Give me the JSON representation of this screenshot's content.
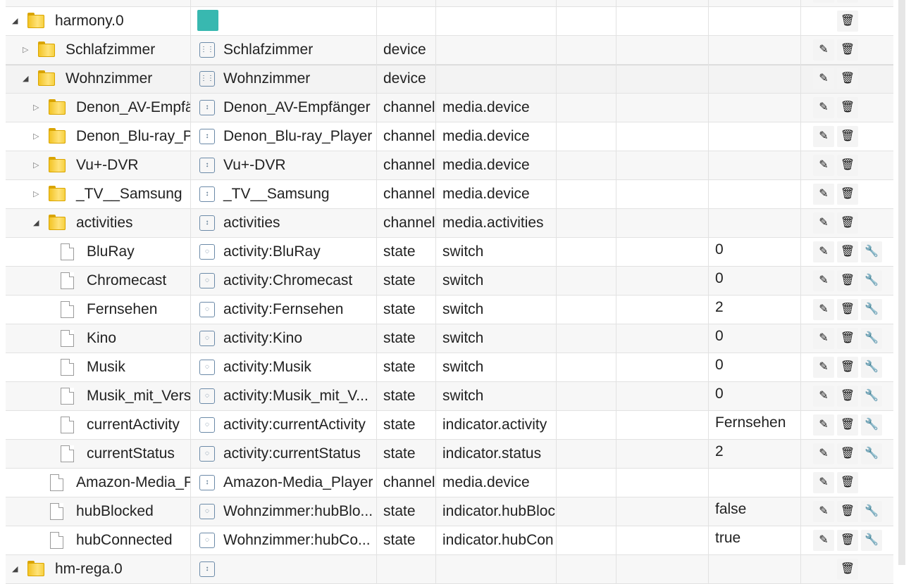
{
  "rows": [
    {
      "name": "",
      "title": "",
      "type": "",
      "role": "",
      "value": "",
      "kind": "folder",
      "toggle": "",
      "indent": 0,
      "icon": "none",
      "actions": [
        "edit",
        "delete"
      ]
    },
    {
      "name": "harmony.0",
      "title": "",
      "type": "",
      "role": "",
      "value": "",
      "kind": "folder",
      "toggle": "open",
      "indent": 0,
      "icon": "adapter-logo",
      "actions": [
        "delete"
      ]
    },
    {
      "name": "Schlafzimmer",
      "title": "Schlafzimmer",
      "type": "device",
      "role": "",
      "value": "",
      "kind": "folder",
      "toggle": "closed",
      "indent": 1,
      "icon": "device-icon",
      "actions": [
        "edit",
        "delete"
      ]
    },
    {
      "name": "Wohnzimmer",
      "title": "Wohnzimmer",
      "type": "device",
      "role": "",
      "value": "",
      "kind": "folder",
      "toggle": "open",
      "indent": 1,
      "icon": "device-icon",
      "actions": [
        "edit",
        "delete"
      ],
      "selected": true
    },
    {
      "name": "Denon_AV-Empfä",
      "title": "Denon_AV-Empfänger",
      "type": "channel",
      "role": "media.device",
      "value": "",
      "kind": "folder",
      "toggle": "closed",
      "indent": 2,
      "icon": "channel-icon",
      "actions": [
        "edit",
        "delete"
      ]
    },
    {
      "name": "Denon_Blu-ray_Pl",
      "title": "Denon_Blu-ray_Player",
      "type": "channel",
      "role": "media.device",
      "value": "",
      "kind": "folder",
      "toggle": "closed",
      "indent": 2,
      "icon": "channel-icon",
      "actions": [
        "edit",
        "delete"
      ]
    },
    {
      "name": "Vu+-DVR",
      "title": "Vu+-DVR",
      "type": "channel",
      "role": "media.device",
      "value": "",
      "kind": "folder",
      "toggle": "closed",
      "indent": 2,
      "icon": "channel-icon",
      "actions": [
        "edit",
        "delete"
      ]
    },
    {
      "name": "_TV__Samsung",
      "title": "_TV__Samsung",
      "type": "channel",
      "role": "media.device",
      "value": "",
      "kind": "folder",
      "toggle": "closed",
      "indent": 2,
      "icon": "channel-icon",
      "actions": [
        "edit",
        "delete"
      ]
    },
    {
      "name": "activities",
      "title": "activities",
      "type": "channel",
      "role": "media.activities",
      "value": "",
      "kind": "folder",
      "toggle": "open",
      "indent": 2,
      "icon": "channel-icon",
      "actions": [
        "edit",
        "delete"
      ]
    },
    {
      "name": "BluRay",
      "title": "activity:BluRay",
      "type": "state",
      "role": "switch",
      "value": "0",
      "kind": "file",
      "toggle": "",
      "indent": 3,
      "icon": "state-icon",
      "actions": [
        "edit",
        "delete",
        "wrench"
      ]
    },
    {
      "name": "Chromecast",
      "title": "activity:Chromecast",
      "type": "state",
      "role": "switch",
      "value": "0",
      "kind": "file",
      "toggle": "",
      "indent": 3,
      "icon": "state-icon",
      "actions": [
        "edit",
        "delete",
        "wrench"
      ]
    },
    {
      "name": "Fernsehen",
      "title": "activity:Fernsehen",
      "type": "state",
      "role": "switch",
      "value": "2",
      "kind": "file",
      "toggle": "",
      "indent": 3,
      "icon": "state-icon",
      "actions": [
        "edit",
        "delete",
        "wrench"
      ]
    },
    {
      "name": "Kino",
      "title": "activity:Kino",
      "type": "state",
      "role": "switch",
      "value": "0",
      "kind": "file",
      "toggle": "",
      "indent": 3,
      "icon": "state-icon",
      "actions": [
        "edit",
        "delete",
        "wrench"
      ]
    },
    {
      "name": "Musik",
      "title": "activity:Musik",
      "type": "state",
      "role": "switch",
      "value": "0",
      "kind": "file",
      "toggle": "",
      "indent": 3,
      "icon": "state-icon",
      "actions": [
        "edit",
        "delete",
        "wrench"
      ]
    },
    {
      "name": "Musik_mit_Vers",
      "title": "activity:Musik_mit_V...",
      "type": "state",
      "role": "switch",
      "value": "0",
      "kind": "file",
      "toggle": "",
      "indent": 3,
      "icon": "state-icon",
      "actions": [
        "edit",
        "delete",
        "wrench"
      ]
    },
    {
      "name": "currentActivity",
      "title": "activity:currentActivity",
      "type": "state",
      "role": "indicator.activity",
      "value": "Fernsehen",
      "kind": "file",
      "toggle": "",
      "indent": 3,
      "icon": "state-icon",
      "actions": [
        "edit",
        "delete",
        "wrench"
      ]
    },
    {
      "name": "currentStatus",
      "title": "activity:currentStatus",
      "type": "state",
      "role": "indicator.status",
      "value": "2",
      "kind": "file",
      "toggle": "",
      "indent": 3,
      "icon": "state-icon",
      "actions": [
        "edit",
        "delete",
        "wrench"
      ]
    },
    {
      "name": "Amazon-Media_P",
      "title": "Amazon-Media_Player",
      "type": "channel",
      "role": "media.device",
      "value": "",
      "kind": "file",
      "toggle": "",
      "indent": 2,
      "icon": "channel-icon",
      "actions": [
        "edit",
        "delete"
      ]
    },
    {
      "name": "hubBlocked",
      "title": "Wohnzimmer:hubBlo...",
      "type": "state",
      "role": "indicator.hubBloc",
      "value": "false",
      "kind": "file",
      "toggle": "",
      "indent": 2,
      "icon": "state-icon",
      "actions": [
        "edit",
        "delete",
        "wrench"
      ]
    },
    {
      "name": "hubConnected",
      "title": "Wohnzimmer:hubCo...",
      "type": "state",
      "role": "indicator.hubCon",
      "value": "true",
      "kind": "file",
      "toggle": "",
      "indent": 2,
      "icon": "state-icon",
      "actions": [
        "edit",
        "delete",
        "wrench"
      ]
    },
    {
      "name": "hm-rega.0",
      "title": "",
      "type": "",
      "role": "",
      "value": "",
      "kind": "folder",
      "toggle": "open",
      "indent": 0,
      "icon": "channel-icon",
      "actions": [
        "delete"
      ]
    }
  ],
  "icons": {
    "edit": "✎",
    "delete": "🗑",
    "wrench": "🔧"
  }
}
